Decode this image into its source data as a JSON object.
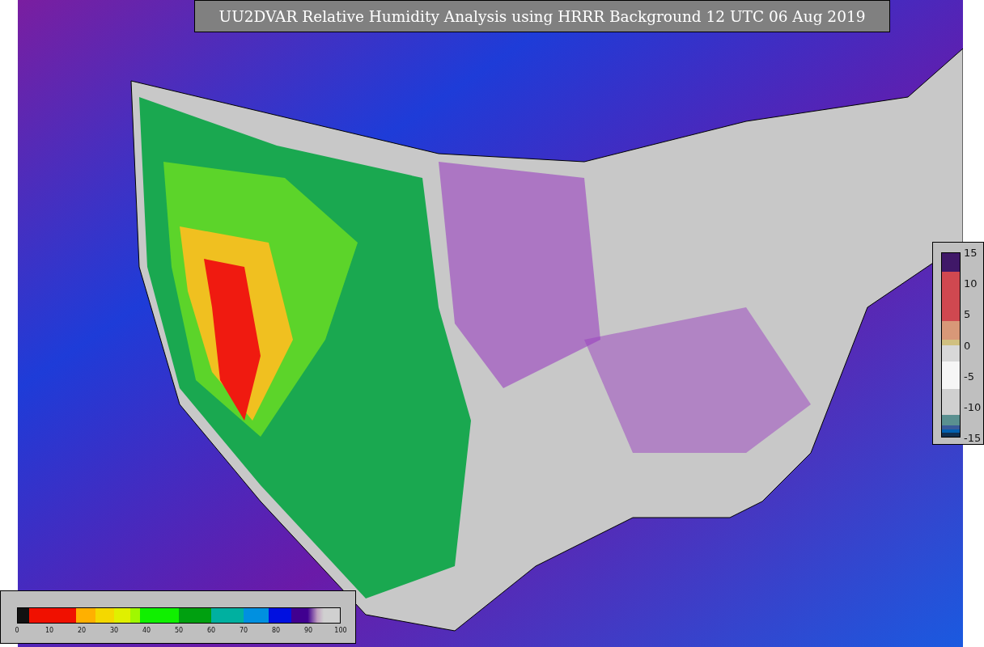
{
  "title": "UU2DVAR Relative Humidity Analysis using HRRR Background 12 UTC 06 Aug 2019",
  "humidity_colorbar": {
    "ticks": [
      "0",
      "10",
      "20",
      "30",
      "40",
      "50",
      "60",
      "70",
      "80",
      "90",
      "100"
    ]
  },
  "difference_colorbar": {
    "ticks": [
      "15",
      "10",
      "5",
      "0",
      "-5",
      "-10",
      "-15"
    ]
  }
}
